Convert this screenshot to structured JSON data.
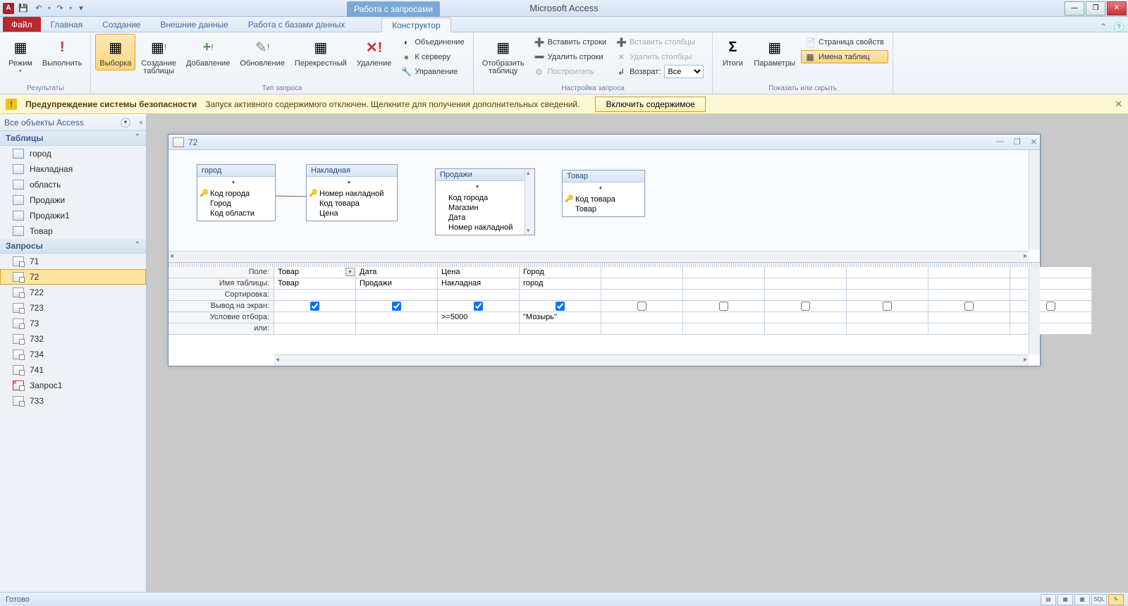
{
  "app": {
    "title": "Microsoft Access",
    "contextual_tab_group": "Работа с запросами"
  },
  "qat": {
    "save": "💾",
    "undo": "↶",
    "redo": "↷",
    "custom": "▾"
  },
  "window_controls": {
    "min": "—",
    "max": "❐",
    "close": "✕"
  },
  "tabs": {
    "file": "Файл",
    "items": [
      "Главная",
      "Создание",
      "Внешние данные",
      "Работа с базами данных"
    ],
    "contextual": "Конструктор"
  },
  "ribbon": {
    "g1": {
      "label": "Результаты",
      "view": "Режим",
      "run": "Выполнить"
    },
    "g2": {
      "label": "Тип запроса",
      "select": "Выборка",
      "maketable": "Создание\nтаблицы",
      "append": "Добавление",
      "update": "Обновление",
      "crosstab": "Перекрестный",
      "delete": "Удаление",
      "union": "Объединение",
      "passthrough": "К серверу",
      "datadef": "Управление"
    },
    "g3": {
      "label": "Настройка запроса",
      "showtable": "Отобразить\nтаблицу",
      "insrows": "Вставить строки",
      "delrows": "Удалить строки",
      "builder": "Построитель",
      "inscols": "Вставить столбцы",
      "delcols": "Удалить столбцы",
      "return": "Возврат:",
      "return_val": "Все"
    },
    "g4": {
      "label": "Показать или скрыть",
      "totals": "Итоги",
      "params": "Параметры",
      "propsheet": "Страница свойств",
      "tablenames": "Имена таблиц"
    }
  },
  "security": {
    "title": "Предупреждение системы безопасности",
    "text": "Запуск активного содержимого отключен. Щелкните для получения дополнительных сведений.",
    "button": "Включить содержимое"
  },
  "nav": {
    "header": "Все объекты Access",
    "sections": {
      "tables": {
        "label": "Таблицы",
        "items": [
          "город",
          "Накладная",
          "область",
          "Продажи",
          "Продажи1",
          "Товар"
        ]
      },
      "queries": {
        "label": "Запросы",
        "items": [
          "71",
          "72",
          "722",
          "723",
          "73",
          "732",
          "734",
          "741",
          "Запрос1",
          "733"
        ],
        "selected": "72"
      }
    }
  },
  "subwindow": {
    "title": "72"
  },
  "diagram": {
    "t1": {
      "name": "город",
      "fields": [
        {
          "n": "*"
        },
        {
          "n": "Код города",
          "k": true
        },
        {
          "n": "Город"
        },
        {
          "n": "Код области"
        }
      ]
    },
    "t2": {
      "name": "Накладная",
      "fields": [
        {
          "n": "*"
        },
        {
          "n": "Номер накладной",
          "k": true
        },
        {
          "n": "Код товара"
        },
        {
          "n": "Цена"
        }
      ]
    },
    "t3": {
      "name": "Продажи",
      "fields": [
        {
          "n": "*"
        },
        {
          "n": "Код города"
        },
        {
          "n": "Магазин"
        },
        {
          "n": "Дата"
        },
        {
          "n": "Номер накладной"
        }
      ]
    },
    "t4": {
      "name": "Товар",
      "fields": [
        {
          "n": "*"
        },
        {
          "n": "Код товара",
          "k": true
        },
        {
          "n": "Товар"
        }
      ]
    }
  },
  "grid": {
    "rows": {
      "field": "Поле:",
      "table": "Имя таблицы:",
      "sort": "Сортировка:",
      "show": "Вывод на экран:",
      "criteria": "Условие отбора:",
      "or": "или:"
    },
    "cols": [
      {
        "field": "Товар",
        "table": "Товар",
        "show": true,
        "criteria": "",
        "or": ""
      },
      {
        "field": "Дата",
        "table": "Продажи",
        "show": true,
        "criteria": "",
        "or": ""
      },
      {
        "field": "Цена",
        "table": "Накладная",
        "show": true,
        "criteria": ">=5000",
        "or": ""
      },
      {
        "field": "Город",
        "table": "город",
        "show": true,
        "criteria": "\"Мозырь\"",
        "or": ""
      },
      {
        "field": "",
        "table": "",
        "show": false,
        "criteria": "",
        "or": ""
      },
      {
        "field": "",
        "table": "",
        "show": false,
        "criteria": "",
        "or": ""
      },
      {
        "field": "",
        "table": "",
        "show": false,
        "criteria": "",
        "or": ""
      },
      {
        "field": "",
        "table": "",
        "show": false,
        "criteria": "",
        "or": ""
      },
      {
        "field": "",
        "table": "",
        "show": false,
        "criteria": "",
        "or": ""
      },
      {
        "field": "",
        "table": "",
        "show": false,
        "criteria": "",
        "or": ""
      }
    ]
  },
  "status": {
    "text": "Готово",
    "views": {
      "ds": "▦",
      "sql": "SQL",
      "dsgn": "✎",
      "extra": "▤"
    }
  }
}
